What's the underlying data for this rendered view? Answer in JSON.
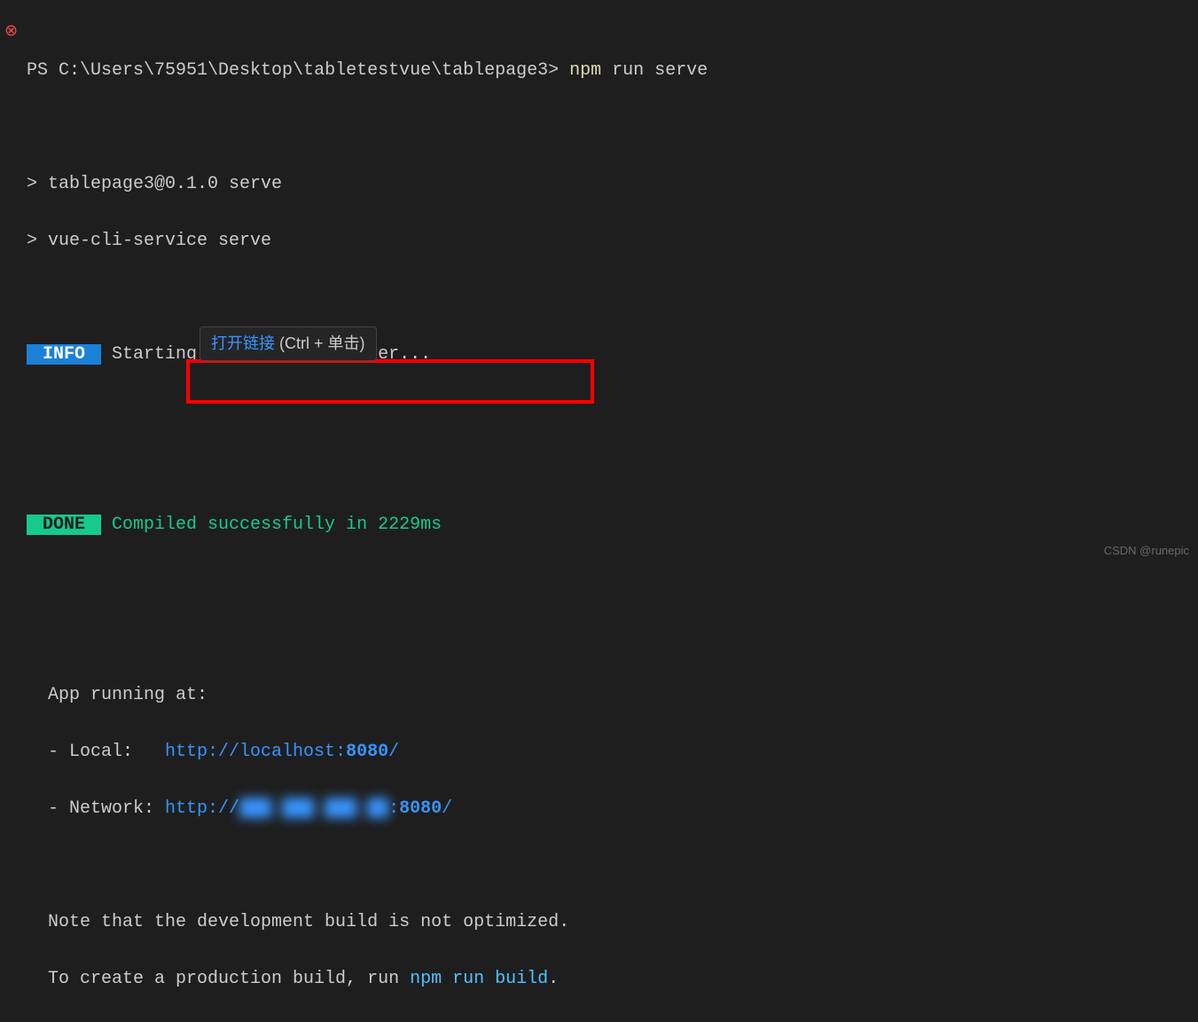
{
  "partial_top": "                                  ",
  "error_icon": "⊗",
  "prompt_prefix": "PS ",
  "prompt_path": "C:\\Users\\75951\\Desktop\\tabletestvue\\tablepage3>",
  "cmd_part1": "npm",
  "cmd_part2": " run serve",
  "out": {
    "pkg_line": "> tablepage3@0.1.0 serve",
    "svc_line": "> vue-cli-service serve"
  },
  "info": {
    "badge": " INFO ",
    "msg": " Starting development server..."
  },
  "done": {
    "badge": " DONE ",
    "msg": " Compiled successfully in 2229ms"
  },
  "app": {
    "running": "  App running at:",
    "local_label": "  - Local:   ",
    "local_url_a": "http://localhost:",
    "local_port": "8080",
    "local_url_b": "/",
    "network_label": "  - Network: ",
    "network_url_a": "http://",
    "network_blur": "███.███.███.██",
    "network_url_c": ":",
    "network_port": "8080",
    "network_url_d": "/"
  },
  "note": {
    "line1": "  Note that the development build is not optimized.",
    "line2a": "  To create a production build, run ",
    "line2b": "npm run build",
    "line2c": "."
  },
  "tooltip": {
    "action": "打开链接",
    "hint": " (Ctrl + 单击)"
  },
  "watermark": "CSDN @runepic"
}
